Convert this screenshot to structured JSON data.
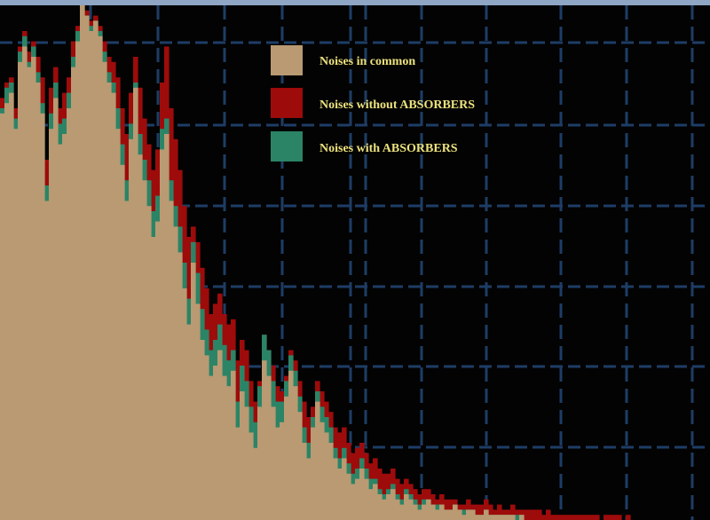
{
  "chart_data": {
    "type": "bar",
    "title": "",
    "xlabel": "",
    "ylabel": "",
    "ylim": [
      0,
      100
    ],
    "grid": true,
    "legend_position": "top-center",
    "series": [
      {
        "name": "Noises in common",
        "color": "#b99a72",
        "values": [
          79,
          81,
          83,
          76,
          89,
          92,
          88,
          90,
          85,
          79,
          62,
          76,
          82,
          73,
          75,
          80,
          88,
          93,
          100,
          98,
          95,
          97,
          94,
          89,
          85,
          83,
          76,
          69,
          62,
          74,
          84,
          71,
          66,
          61,
          55,
          58,
          72,
          75,
          62,
          57,
          52,
          45,
          38,
          50,
          42,
          35,
          32,
          28,
          30,
          33,
          28,
          26,
          29,
          18,
          25,
          22,
          17,
          14,
          22,
          31,
          28,
          22,
          18,
          19,
          24,
          29,
          26,
          21,
          15,
          12,
          18,
          23,
          19,
          17,
          15,
          12,
          10,
          12,
          9,
          7,
          8,
          10,
          8,
          6,
          7,
          5,
          4,
          5,
          6,
          4,
          3,
          5,
          4,
          3,
          2,
          3,
          4,
          3,
          2,
          3,
          2,
          2,
          3,
          2,
          1,
          2,
          2,
          1,
          1,
          2,
          1,
          1,
          1,
          1,
          1,
          1,
          0,
          1,
          0,
          0,
          0,
          0,
          0,
          0,
          0,
          0,
          0,
          0,
          0,
          0,
          0,
          0,
          0,
          0,
          0,
          0,
          0,
          0,
          0,
          0,
          0,
          0,
          0,
          0,
          0,
          0,
          0,
          0,
          0,
          0,
          0,
          0,
          0,
          0,
          0,
          0,
          0,
          0,
          0,
          0
        ]
      },
      {
        "name": "Noises without ABSORBERS",
        "color": "#9e0b0b",
        "values": [
          82,
          85,
          86,
          80,
          92,
          95,
          91,
          93,
          90,
          86,
          70,
          84,
          88,
          80,
          83,
          86,
          93,
          96,
          100,
          99,
          97,
          98,
          96,
          93,
          90,
          89,
          86,
          80,
          75,
          83,
          90,
          84,
          78,
          73,
          68,
          72,
          85,
          92,
          80,
          74,
          68,
          61,
          55,
          57,
          54,
          49,
          45,
          40,
          42,
          44,
          40,
          38,
          39,
          31,
          35,
          33,
          27,
          23,
          27,
          36,
          33,
          30,
          26,
          25,
          28,
          33,
          31,
          27,
          23,
          20,
          22,
          27,
          25,
          23,
          21,
          18,
          17,
          18,
          15,
          13,
          14,
          15,
          13,
          11,
          12,
          10,
          9,
          9,
          10,
          8,
          7,
          8,
          7,
          6,
          5,
          6,
          6,
          5,
          4,
          5,
          4,
          4,
          4,
          3,
          3,
          4,
          3,
          3,
          3,
          4,
          3,
          2,
          3,
          2,
          2,
          3,
          2,
          2,
          2,
          2,
          2,
          2,
          1,
          2,
          1,
          1,
          1,
          1,
          1,
          1,
          1,
          1,
          1,
          1,
          1,
          0,
          1,
          1,
          1,
          1,
          0,
          1,
          0,
          0,
          0,
          0,
          0,
          0,
          0,
          0,
          0,
          0,
          0,
          0,
          0,
          0,
          0,
          0,
          0,
          0
        ]
      },
      {
        "name": "Noises with ABSORBERS",
        "color": "#2c8466",
        "values": [
          80,
          84,
          85,
          78,
          91,
          94,
          89,
          92,
          87,
          81,
          65,
          79,
          85,
          77,
          78,
          83,
          90,
          95,
          100,
          98,
          96,
          97,
          95,
          91,
          87,
          85,
          80,
          73,
          66,
          77,
          85,
          75,
          70,
          66,
          60,
          63,
          76,
          78,
          66,
          61,
          57,
          50,
          43,
          54,
          48,
          41,
          37,
          33,
          35,
          38,
          34,
          31,
          33,
          23,
          30,
          27,
          22,
          19,
          26,
          36,
          33,
          27,
          23,
          23,
          27,
          32,
          29,
          24,
          18,
          15,
          20,
          25,
          22,
          20,
          18,
          14,
          12,
          14,
          11,
          9,
          10,
          12,
          10,
          8,
          8,
          6,
          5,
          6,
          7,
          5,
          4,
          6,
          5,
          4,
          3,
          4,
          4,
          3,
          3,
          3,
          2,
          2,
          3,
          2,
          2,
          2,
          2,
          1,
          1,
          2,
          1,
          1,
          1,
          1,
          1,
          1,
          1,
          1,
          0,
          0,
          0,
          0,
          0,
          0,
          0,
          0,
          0,
          0,
          0,
          0,
          0,
          0,
          0,
          0,
          0,
          0,
          0,
          0,
          0,
          0,
          0,
          0,
          0,
          0,
          0,
          0,
          0,
          0,
          0,
          0,
          0,
          0,
          0,
          0,
          0,
          0,
          0,
          0,
          0,
          0
        ]
      }
    ]
  },
  "colors": {
    "background": "#030303",
    "grid": "#1e3d66",
    "top_border": "#8fa6c4",
    "legend_text": "#ece27e"
  }
}
